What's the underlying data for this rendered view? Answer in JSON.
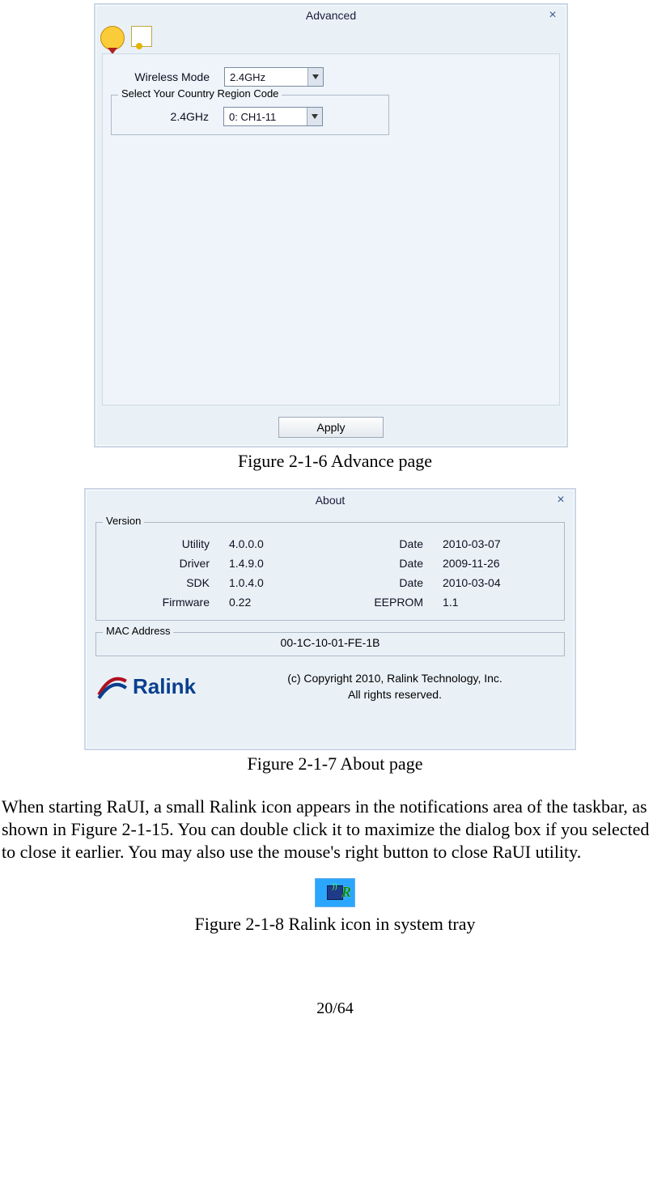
{
  "advance_window": {
    "title": "Advanced",
    "wireless_mode_label": "Wireless Mode",
    "wireless_mode_value": "2.4GHz",
    "region_group_label": "Select Your Country Region Code",
    "region_band_label": "2.4GHz",
    "region_value": "0: CH1-11",
    "apply_label": "Apply"
  },
  "caption1": "Figure 2-1-6 Advance page",
  "about_window": {
    "title": "About",
    "version_group_label": "Version",
    "rows": [
      {
        "name": "Utility",
        "ver": "4.0.0.0",
        "k2": "Date",
        "v2": "2010-03-07"
      },
      {
        "name": "Driver",
        "ver": "1.4.9.0",
        "k2": "Date",
        "v2": "2009-11-26"
      },
      {
        "name": "SDK",
        "ver": "1.0.4.0",
        "k2": "Date",
        "v2": "2010-03-04"
      },
      {
        "name": "Firmware",
        "ver": "0.22",
        "k2": "EEPROM",
        "v2": "1.1"
      }
    ],
    "mac_group_label": "MAC Address",
    "mac_value": "00-1C-10-01-FE-1B",
    "logo_text": "Ralink",
    "copyright_line1": "(c) Copyright 2010, Ralink Technology, Inc.",
    "copyright_line2": "All rights reserved."
  },
  "caption2": "Figure 2-1-7 About page",
  "body_paragraph": "When starting RaUI, a small Ralink icon appears in the notifications area of the taskbar, as shown in Figure 2-1-15. You can double click it to maximize the dialog box if you selected to close it earlier. You may also use the mouse's right button to close RaUI utility.",
  "caption3": "Figure 2-1-8 Ralink icon in system tray",
  "page_number": "20/64"
}
